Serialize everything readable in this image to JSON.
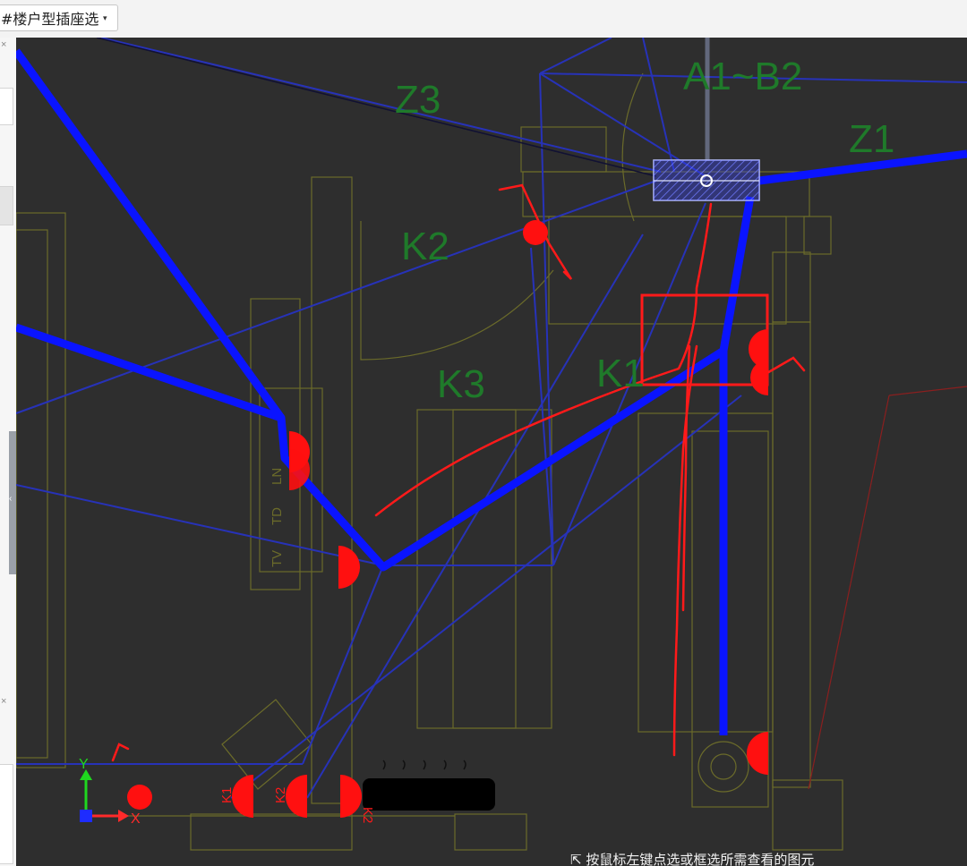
{
  "toolbar": {
    "dropdown_value": "#楼户型插座选",
    "dropdown_caret": "▾"
  },
  "left_panel": {
    "close_glyph": "×",
    "splitter_glyph": "‹"
  },
  "drawing": {
    "zone_labels": [
      "Z3",
      "A1~B2",
      "Z1",
      "K2",
      "K3",
      "K1"
    ],
    "symbol_labels": [
      "K1",
      "K2",
      "K2",
      "TV",
      "TD",
      "LN"
    ],
    "axis_labels": {
      "y": "Y",
      "x": "X"
    }
  },
  "status_bar": {
    "prompt_text": "⇱ 按鼠标左键点选或框选所需查看的图元"
  },
  "colors": {
    "canvas_bg": "#2e2e2e",
    "wire_blue": "#0a14ff",
    "wire_blue_faint": "#2732b8",
    "markup_red": "#ff1a1a",
    "outline_olive": "#6b6b2a",
    "zone_green": "#1f7a2a"
  }
}
